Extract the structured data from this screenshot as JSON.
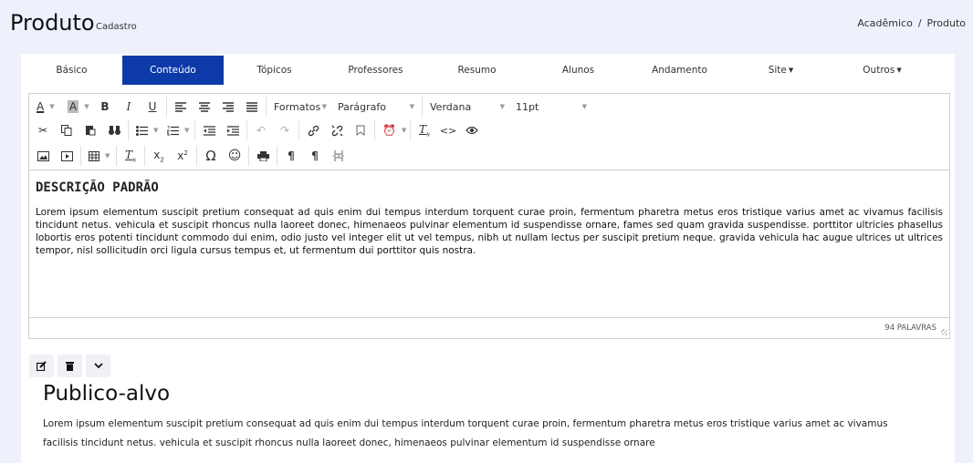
{
  "header": {
    "title": "Produto",
    "subtitle": "Cadastro",
    "breadcrumb": [
      "Acadêmico",
      "/",
      "Produto"
    ]
  },
  "tabs": [
    {
      "label": "Básico",
      "active": false
    },
    {
      "label": "Conteúdo",
      "active": true
    },
    {
      "label": "Tópicos",
      "active": false
    },
    {
      "label": "Professores",
      "active": false
    },
    {
      "label": "Resumo",
      "active": false
    },
    {
      "label": "Alunos",
      "active": false
    },
    {
      "label": "Andamento",
      "active": false
    },
    {
      "label": "Site",
      "active": false,
      "dropdown": true
    },
    {
      "label": "Outros",
      "active": false,
      "dropdown": true
    }
  ],
  "editor": {
    "formats_label": "Formatos",
    "block_label": "Parágrafo",
    "font_label": "Verdana",
    "size_label": "11pt",
    "content_heading": "DESCRIÇÃO PADRÃO",
    "content_body": "Lorem ipsum elementum suscipit pretium consequat ad quis enim dui tempus interdum torquent curae proin, fermentum pharetra metus eros tristique varius amet ac vivamus facilisis tincidunt netus. vehicula et suscipit rhoncus nulla laoreet donec, himenaeos pulvinar elementum id suspendisse ornare, fames sed quam gravida suspendisse. porttitor ultricies phasellus lobortis eros potenti tincidunt commodo dui enim, odio justo vel integer elit ut vel tempus, nibh ut nullam lectus per suscipit pretium neque. gravida vehicula hac augue ultrices ut ultrices tempor, nisl sollicitudin orci ligula cursus tempus et, ut fermentum dui porttitor quis nostra.",
    "word_count": "94 PALAVRAS"
  },
  "section": {
    "title": "Publico-alvo",
    "body": "Lorem ipsum elementum suscipit pretium consequat ad quis enim dui tempus interdum torquent curae proin, fermentum pharetra metus eros tristique varius amet ac vivamus facilisis tincidunt netus. vehicula et suscipit rhoncus nulla laoreet donec, himenaeos pulvinar elementum id suspendisse ornare"
  },
  "colors": {
    "active_tab": "#0c3aa8",
    "page_bg": "#eef0fb"
  }
}
